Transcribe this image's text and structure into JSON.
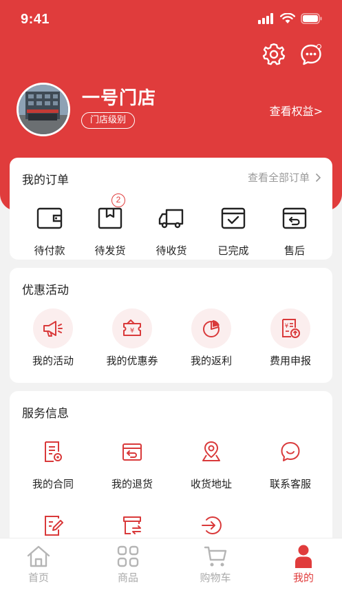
{
  "status": {
    "time": "9:41"
  },
  "store": {
    "name": "一号门店",
    "level_label": "门店级别",
    "benefits_link": "查看权益>"
  },
  "orders": {
    "title": "我的订单",
    "view_all": "查看全部订单",
    "items": [
      {
        "label": "待付款",
        "icon": "wallet-icon"
      },
      {
        "label": "待发货",
        "icon": "package-icon",
        "badge": "2"
      },
      {
        "label": "待收货",
        "icon": "truck-icon"
      },
      {
        "label": "已完成",
        "icon": "box-check-icon"
      },
      {
        "label": "售后",
        "icon": "return-box-icon"
      }
    ]
  },
  "promotions": {
    "title": "优惠活动",
    "items": [
      {
        "label": "我的活动",
        "icon": "megaphone-icon"
      },
      {
        "label": "我的优惠券",
        "icon": "coupon-icon"
      },
      {
        "label": "我的返利",
        "icon": "pie-chart-icon"
      },
      {
        "label": "费用申报",
        "icon": "expense-report-icon"
      }
    ]
  },
  "services": {
    "title": "服务信息",
    "items": [
      {
        "label": "我的合同",
        "icon": "contract-icon"
      },
      {
        "label": "我的退货",
        "icon": "return-icon"
      },
      {
        "label": "收货地址",
        "icon": "location-icon"
      },
      {
        "label": "联系客服",
        "icon": "chat-icon"
      },
      {
        "label": "",
        "icon": "edit-document-icon"
      },
      {
        "label": "",
        "icon": "store-exchange-icon"
      },
      {
        "label": "",
        "icon": "login-arrow-icon"
      }
    ]
  },
  "tabbar": {
    "items": [
      {
        "label": "首页",
        "icon": "home-icon",
        "active": false
      },
      {
        "label": "商品",
        "icon": "grid-icon",
        "active": false
      },
      {
        "label": "购物车",
        "icon": "cart-icon",
        "active": false
      },
      {
        "label": "我的",
        "icon": "user-icon",
        "active": true
      }
    ]
  },
  "colors": {
    "brand": "#e03c3c",
    "tab_inactive": "#aaaaaa",
    "icon_bg": "#fbeeee"
  }
}
